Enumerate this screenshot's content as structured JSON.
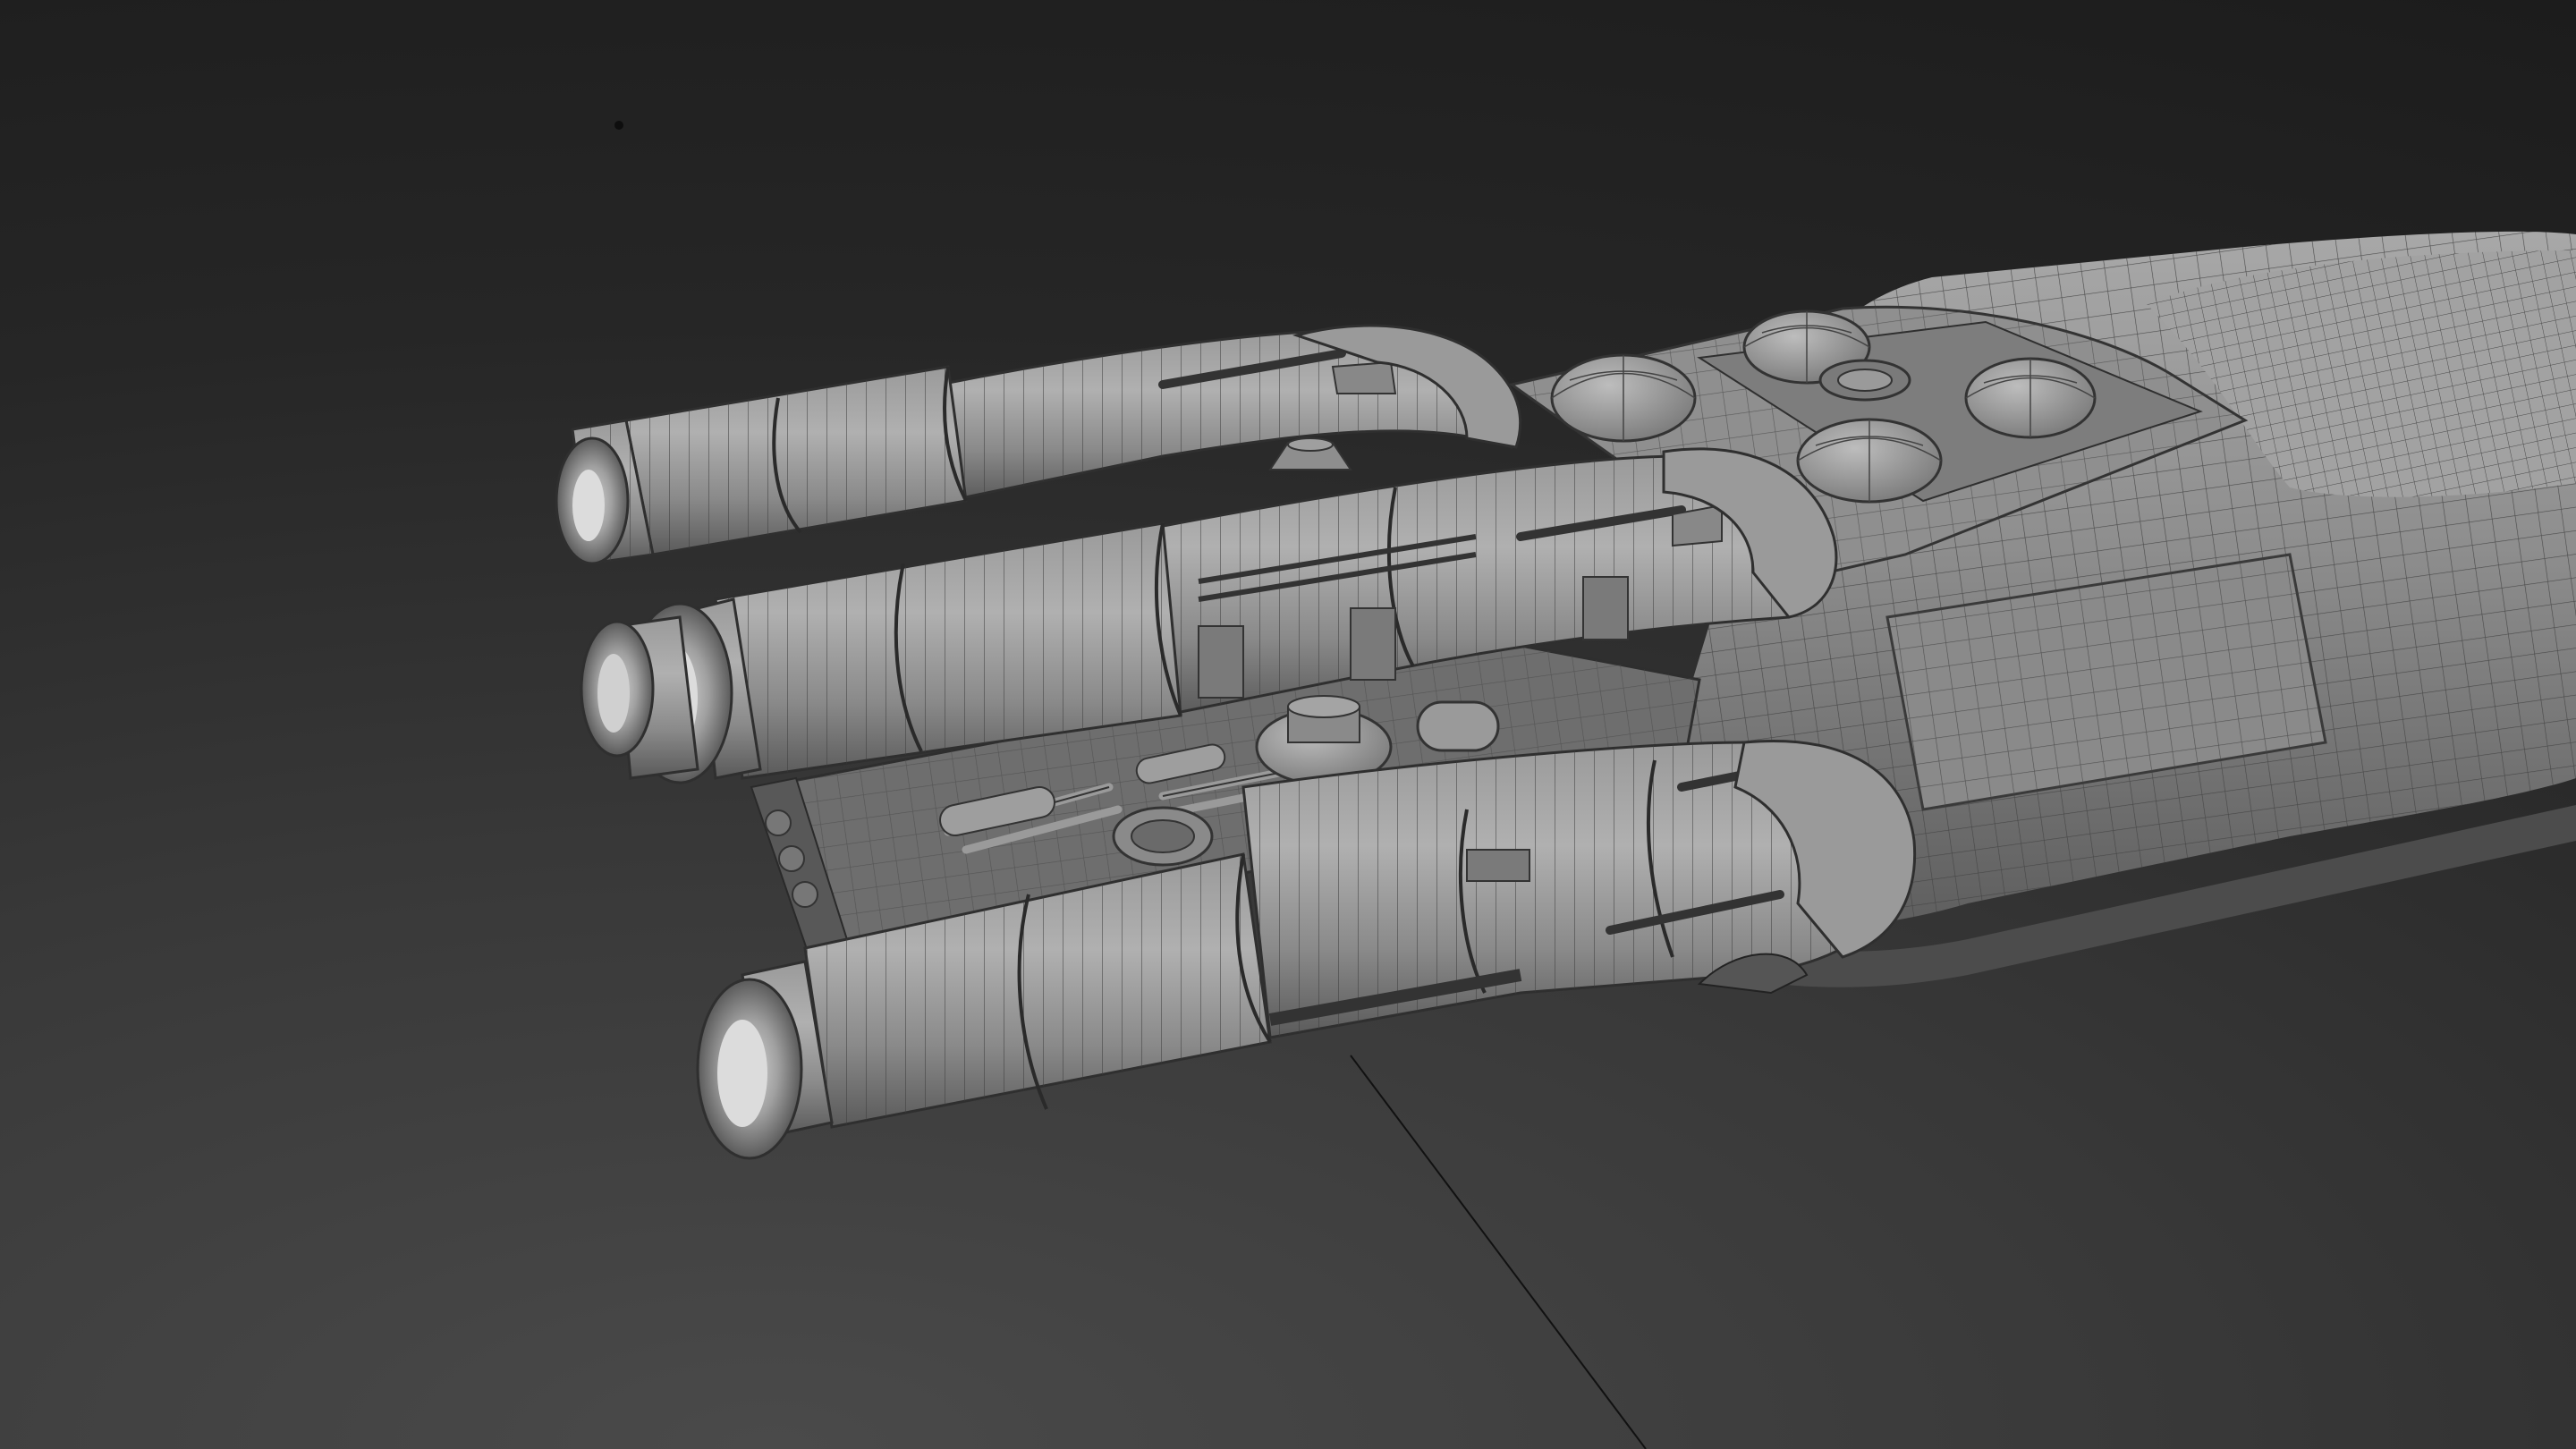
{
  "viewport": {
    "kind": "3d-modeling-viewport",
    "display_mode": "wireframe-on-shaded",
    "background_top": "#1a1a1a",
    "background_bottom": "#4a4a4a"
  },
  "model": {
    "subject": "spaceship-engine-section",
    "base_color": "#8c8c8c",
    "wire_color": "#3a3a3a",
    "engines": [
      "engine-top",
      "engine-middle-left",
      "engine-middle-right",
      "engine-bottom"
    ],
    "domes": [
      "dome-1",
      "dome-2",
      "dome-3",
      "dome-4",
      "dome-5"
    ]
  },
  "scene_objects": {
    "debug_line": "light-ray-line",
    "cursor_dot": "cursor-dot"
  }
}
